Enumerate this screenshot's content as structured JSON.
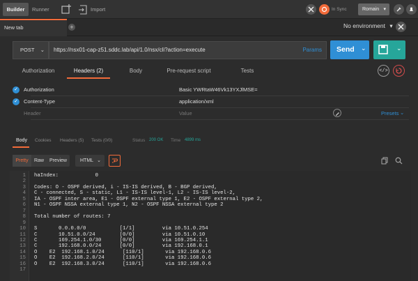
{
  "topbar": {
    "builder": "Builder",
    "runner": "Runner",
    "import": "Import",
    "sync": "In Sync",
    "user": "Romain"
  },
  "tabs": {
    "active": "New tab"
  },
  "env": {
    "label": "No environment"
  },
  "request": {
    "method": "POST",
    "url": "https://nsx01-cap-z51.sddc.lab/api/1.0/nsx/cli?action=execute",
    "params": "Params",
    "send": "Send"
  },
  "request_tabs": [
    "Authorization",
    "Headers (2)",
    "Body",
    "Pre-request script",
    "Tests"
  ],
  "headers": [
    {
      "key": "Authorization",
      "value": "Basic YWRtaW46Vk13YXJlMSE="
    },
    {
      "key": "Content-Type",
      "value": "application/xml"
    }
  ],
  "header_placeholder": {
    "key": "Header",
    "value": "Value"
  },
  "presets": "Presets",
  "response_tabs": {
    "body": "Body",
    "cookies": "Cookies",
    "headers": "Headers (5)",
    "tests": "Tests (0/0)"
  },
  "status": {
    "label": "Status",
    "value": "200 OK",
    "time_label": "Time",
    "time_value": "4899 ms"
  },
  "view": {
    "pretty": "Pretty",
    "raw": "Raw",
    "preview": "Preview",
    "format": "HTML"
  },
  "code_lines": [
    "haIndex:            0",
    "",
    "Codes: O - OSPF derived, i - IS-IS derived, B - BGP derived,",
    "C - connected, S - static, L1 - IS-IS level-1, L2 - IS-IS level-2,",
    "IA - OSPF inter area, E1 - OSPF external type 1, E2 - OSPF external type 2,",
    "N1 - OSPF NSSA external type 1, N2 - OSPF NSSA external type 2",
    "",
    "Total number of routes: 7",
    "",
    "S       0.0.0.0/0           [1/1]         via 10.51.0.254",
    "C       10.51.0.0/24        [0/0]         via 10.51.0.10",
    "C       169.254.1.0/30      [0/0]         via 169.254.1.1",
    "C       192.168.0.0/24      [0/0]         via 192.168.0.1",
    "O    E2  192.168.1.0/24      [110/1]       via 192.168.0.6",
    "O    E2  192.168.2.0/24      [110/1]       via 192.168.0.6",
    "O    E2  192.168.3.0/24      [110/1]       via 192.168.0.6",
    ""
  ],
  "colors": {
    "send": "#2f8fd5",
    "save": "#26a69a",
    "accent": "#f26b3a",
    "check": "#2f8fd5"
  }
}
